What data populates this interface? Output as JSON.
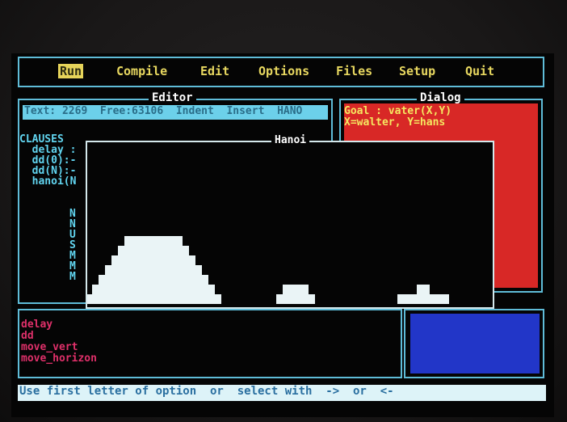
{
  "menu": {
    "items": [
      {
        "label": "Run",
        "selected": true
      },
      {
        "label": "Compile",
        "selected": false
      },
      {
        "label": "Edit",
        "selected": false
      },
      {
        "label": "Options",
        "selected": false
      },
      {
        "label": "Files",
        "selected": false
      },
      {
        "label": "Setup",
        "selected": false
      },
      {
        "label": "Quit",
        "selected": false
      }
    ]
  },
  "editor": {
    "title": "Editor",
    "status_line": "Text: 2269  Free:63106  Indent  Insert  HANO",
    "clauses": [
      "CLAUSES",
      "  delay :",
      "  dd(0):-",
      "  dd(N):-",
      "",
      "  hanoi(N"
    ],
    "hanoi_args": [
      "N",
      "N",
      "U",
      "S",
      "M",
      "M",
      "M"
    ]
  },
  "dialog": {
    "title": "Dialog",
    "lines": [
      "Goal : vater(X,Y)",
      "X=walter, Y=hans"
    ]
  },
  "hanoi_window": {
    "title": "Hanoi",
    "pegs": [
      {
        "disks": 7
      },
      {
        "disks": 2
      },
      {
        "disks": 2
      }
    ]
  },
  "list": {
    "items": [
      "delay",
      "dd",
      "move_vert",
      "move_horizon"
    ]
  },
  "hint": {
    "text": "Use first letter of option  or  select with  ->  or  <-"
  },
  "colors": {
    "menu_text": "#e8d860",
    "frame": "#5fbcd8",
    "dialog_bg": "#d82826",
    "blue_panel": "#2236c8",
    "disk": "#eaf4f6"
  }
}
